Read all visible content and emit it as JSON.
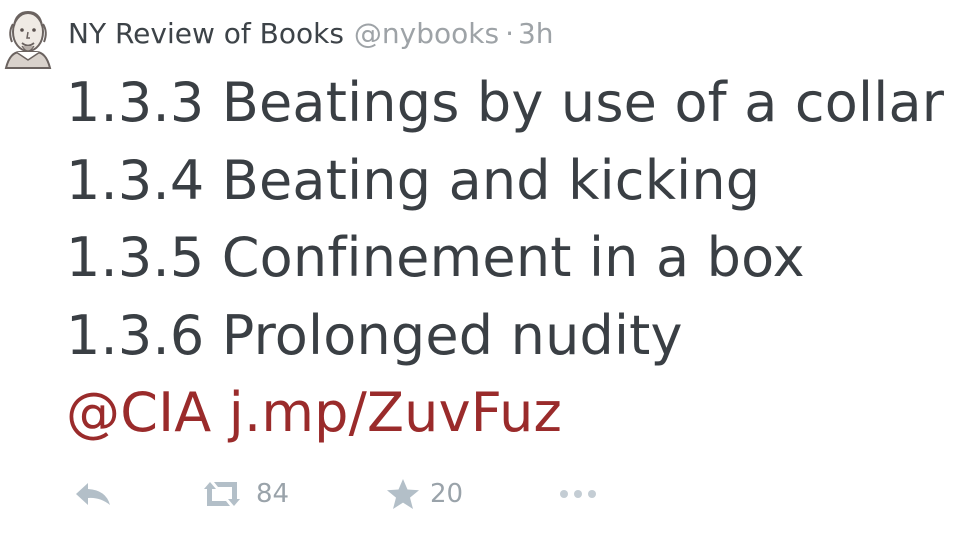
{
  "tweet": {
    "author_name": "NY Review of Books",
    "handle": "@nybooks",
    "separator": "·",
    "time": "3h",
    "lines": [
      "1.3.3 Beatings by use of a collar",
      "1.3.4 Beating and kicking",
      "1.3.5 Confinement in a box",
      "1.3.6 Prolonged nudity"
    ],
    "mention": "@CIA",
    "link": "j.mp/ZuvFuz"
  },
  "actions": {
    "reply_icon": "reply-icon",
    "retweet_icon": "retweet-icon",
    "retweet_count": "84",
    "favorite_icon": "star-icon",
    "favorite_count": "20",
    "more_icon": "more-icon"
  },
  "colors": {
    "link": "#9a2b2b",
    "text": "#3a3f44",
    "muted": "#9ea3a7",
    "action_icon": "#aab8c2"
  }
}
